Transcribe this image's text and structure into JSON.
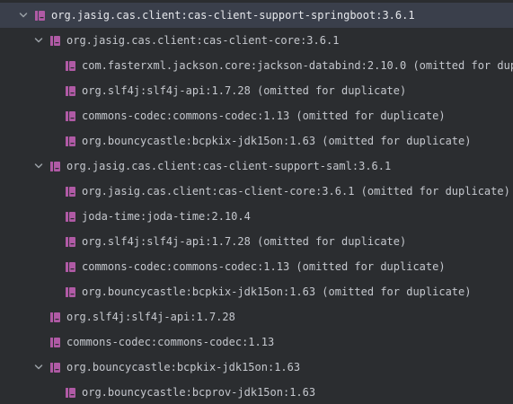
{
  "colors": {
    "background": "#2b2d30",
    "selected_row": "#3a3f4b",
    "text": "#c5c8ce",
    "library_icon": "#b05aa5",
    "chevron": "#9aa0a6"
  },
  "icons": {
    "expanded": "chevron-down-icon",
    "library": "library-icon"
  },
  "rows": [
    {
      "label": "org.jasig.cas.client:cas-client-support-springboot:3.6.1",
      "level": 0,
      "expanded": true,
      "selected": true
    },
    {
      "label": "org.jasig.cas.client:cas-client-core:3.6.1",
      "level": 1,
      "expanded": true
    },
    {
      "label": "com.fasterxml.jackson.core:jackson-databind:2.10.0 (omitted for duplic",
      "level": 2
    },
    {
      "label": "org.slf4j:slf4j-api:1.7.28 (omitted for duplicate)",
      "level": 2
    },
    {
      "label": "commons-codec:commons-codec:1.13 (omitted for duplicate)",
      "level": 2
    },
    {
      "label": "org.bouncycastle:bcpkix-jdk15on:1.63 (omitted for duplicate)",
      "level": 2
    },
    {
      "label": "org.jasig.cas.client:cas-client-support-saml:3.6.1",
      "level": 1,
      "expanded": true
    },
    {
      "label": "org.jasig.cas.client:cas-client-core:3.6.1 (omitted for duplicate)",
      "level": 2
    },
    {
      "label": "joda-time:joda-time:2.10.4",
      "level": 2
    },
    {
      "label": "org.slf4j:slf4j-api:1.7.28 (omitted for duplicate)",
      "level": 2
    },
    {
      "label": "commons-codec:commons-codec:1.13 (omitted for duplicate)",
      "level": 2
    },
    {
      "label": "org.bouncycastle:bcpkix-jdk15on:1.63 (omitted for duplicate)",
      "level": 2
    },
    {
      "label": "org.slf4j:slf4j-api:1.7.28",
      "level": 1
    },
    {
      "label": "commons-codec:commons-codec:1.13",
      "level": 1
    },
    {
      "label": "org.bouncycastle:bcpkix-jdk15on:1.63",
      "level": 1,
      "expanded": true
    },
    {
      "label": "org.bouncycastle:bcprov-jdk15on:1.63",
      "level": 2
    }
  ]
}
